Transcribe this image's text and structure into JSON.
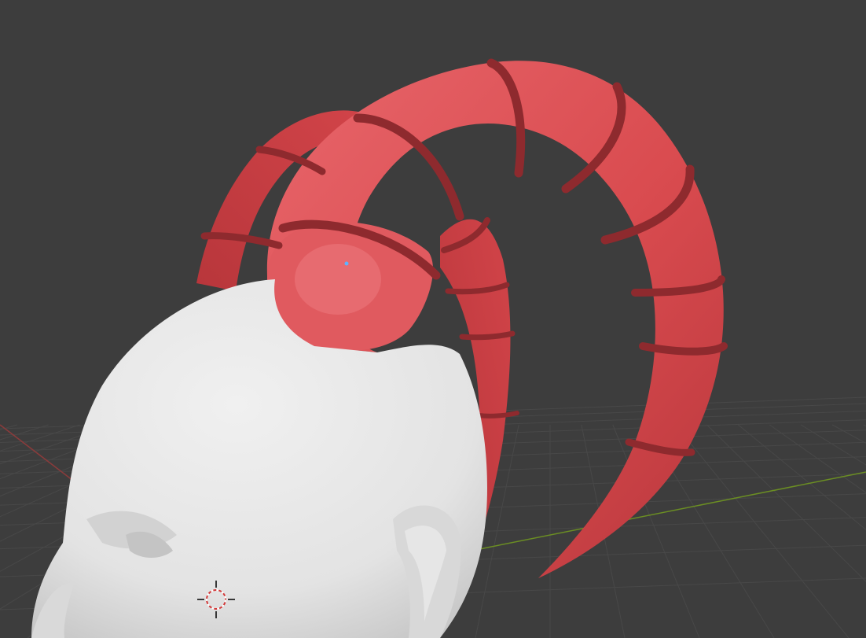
{
  "viewport": {
    "background_color": "#3d3d3d",
    "grid_color": "#484848",
    "x_axis_color": "#8a3b3b",
    "y_axis_color": "#6b8e23"
  },
  "objects": [
    {
      "name": "head",
      "color": "#e6e6e6"
    },
    {
      "name": "horns",
      "color": "#d94b4f",
      "band_color": "#8e2a2e"
    }
  ],
  "overlay": {
    "cursor_icon": "3d-cursor-icon",
    "origin_dot_color": "#5db3ff"
  }
}
